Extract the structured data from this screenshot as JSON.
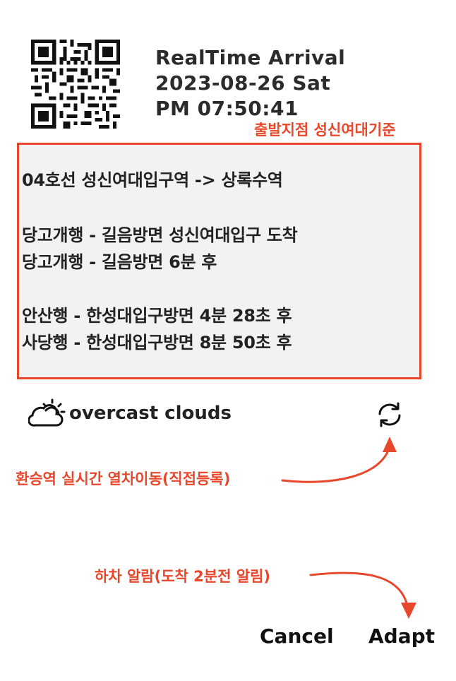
{
  "header": {
    "title": "RealTime Arrival",
    "date": "2023-08-26 Sat",
    "time": "PM 07:50:41"
  },
  "annotations": {
    "origin": "출발지점 성신여대기준",
    "transfer": "환승역 실시간 열차이동(직접등록)",
    "alarm": "하차 알람(도착 2분전 알림)"
  },
  "info": {
    "route": "04호선 성신여대입구역 -> 상록수역",
    "lines": [
      "당고개행 - 길음방면 성신여대입구 도착",
      "당고개행 - 길음방면 6분 후",
      "안산행 - 한성대입구방면 4분 28초 후",
      "사당행 - 한성대입구방면 8분 50초 후"
    ]
  },
  "weather": {
    "icon": "cloud-sun-icon",
    "text": "overcast clouds"
  },
  "refresh": {
    "icon": "refresh-icon"
  },
  "buttons": {
    "cancel": "Cancel",
    "adapt": "Adapt"
  },
  "colors": {
    "accent": "#e8472b",
    "box_bg": "#f2f2f2",
    "text": "#222222"
  }
}
